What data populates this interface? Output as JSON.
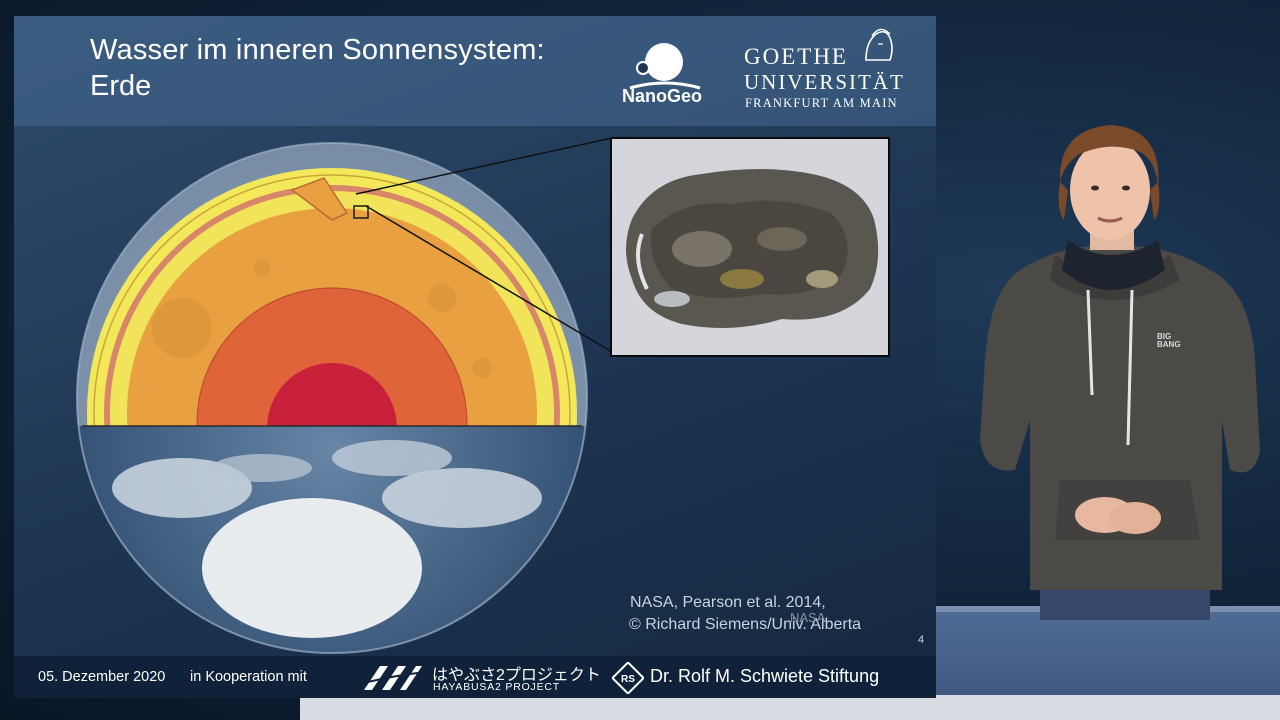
{
  "slide": {
    "title": "Wasser im inneren Sonnensystem:",
    "subtitle": "Erde",
    "logos": {
      "nanogeo_label": "NanoGeo",
      "goethe_line1": "GOETHE",
      "goethe_line2": "UNIVERSITÄT",
      "goethe_line3": "FRANKFURT AM MAIN"
    },
    "credits": {
      "line1": "NASA, Pearson et al. 2014,",
      "line2": "© Richard Siemens/Univ. Alberta",
      "line3": "NASA"
    },
    "slide_number": "4",
    "footer": {
      "date": "05. Dezember 2020",
      "cooperation": "in Kooperation mit",
      "hayabusa_jp": "はやぶさ2プロジェクト",
      "hayabusa_en": "HAYABUSA2 PROJECT",
      "foundation": "Dr. Rolf M. Schwiete Stiftung"
    }
  },
  "presenter": {
    "hoodie_logo": "BIG BANG"
  },
  "colors": {
    "slide_bg": "#1d3552",
    "header_bg": "#46698f",
    "footer_bg": "#0f223a",
    "crust_yellow": "#f2e85a",
    "mantle_orange": "#e8a040",
    "outer_core": "#e0643a",
    "inner_core": "#c8203a"
  }
}
